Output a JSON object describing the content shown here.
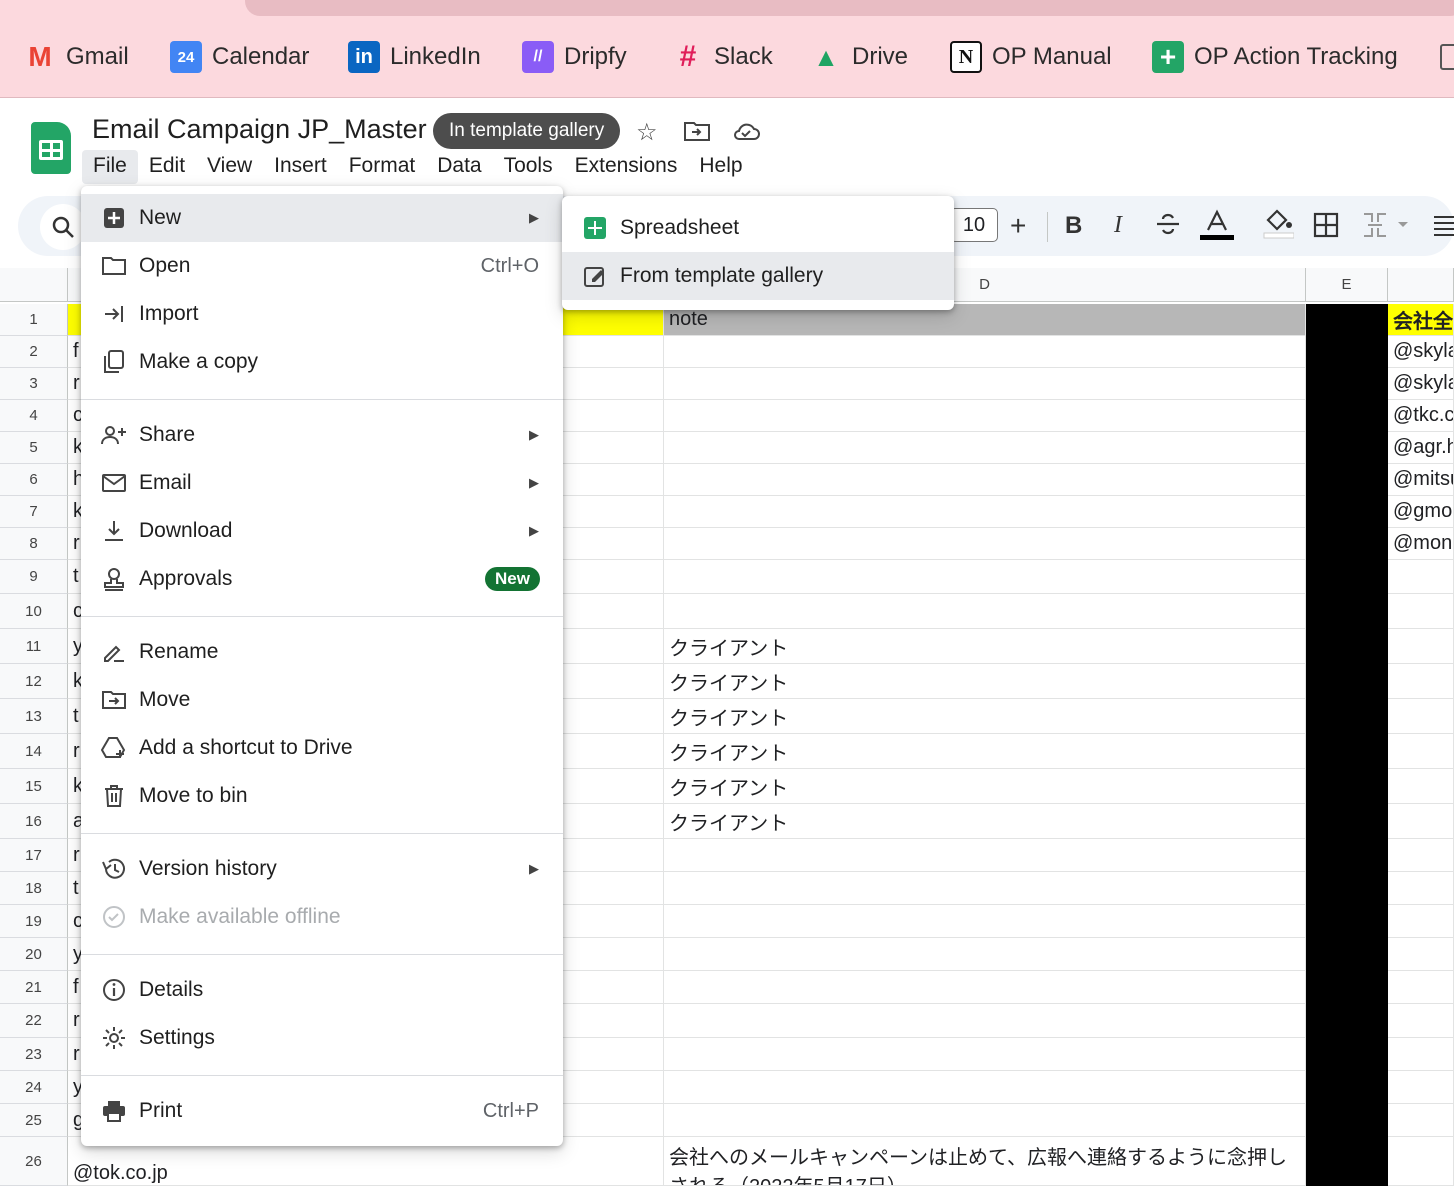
{
  "bookmarks": [
    {
      "label": "Gmail",
      "icon": "gmail-icon",
      "glyph": "M",
      "color": "#ea4335"
    },
    {
      "label": "Calendar",
      "icon": "calendar-icon",
      "glyph": "24",
      "color": "#4285f4"
    },
    {
      "label": "LinkedIn",
      "icon": "linkedin-icon",
      "glyph": "in",
      "color": "#0a66c2"
    },
    {
      "label": "Dripfy",
      "icon": "dripfy-icon",
      "glyph": "//",
      "color": "#8a5cf6"
    },
    {
      "label": "Slack",
      "icon": "slack-icon",
      "glyph": "#",
      "color": "#e01e5a"
    },
    {
      "label": "Drive",
      "icon": "drive-icon",
      "glyph": "▲",
      "color": "#1fa463"
    },
    {
      "label": "OP Manual",
      "icon": "notion-icon",
      "glyph": "N",
      "color": "#111111"
    },
    {
      "label": "OP Action Tracking",
      "icon": "sheets-plus-icon",
      "glyph": "+",
      "color": "#23a566"
    }
  ],
  "doc": {
    "title": "Email Campaign JP_Master",
    "badge": "In template gallery"
  },
  "menubar": [
    "File",
    "Edit",
    "View",
    "Insert",
    "Format",
    "Data",
    "Tools",
    "Extensions",
    "Help"
  ],
  "toolbar": {
    "font_size": "10",
    "plus": "+",
    "bold": "B",
    "italic": "I"
  },
  "columns": {
    "d": "D",
    "e": "E"
  },
  "rows": [
    "1",
    "2",
    "3",
    "4",
    "5",
    "6",
    "7",
    "8",
    "9",
    "10",
    "11",
    "12",
    "13",
    "14",
    "15",
    "16",
    "17",
    "18",
    "19",
    "20",
    "21",
    "22",
    "23",
    "24",
    "25",
    "26"
  ],
  "col_a_fragments": [
    "f",
    "r",
    "c",
    "k",
    "h",
    "k",
    "r",
    "t",
    "c",
    "y",
    "k",
    "t",
    "r",
    "k",
    "a",
    "r",
    "t",
    "c",
    "y",
    "f",
    "r",
    "r",
    "y",
    "g",
    "k"
  ],
  "col_a_row26": "@tok.co.jp",
  "col_d": {
    "header_note": "note",
    "client": "クライアント",
    "row26_line1": "会社へのメールキャンペーンは止めて、広報へ連絡するように念押し",
    "row26_line2": "される（2022年5月17日）"
  },
  "col_f": [
    "会社全",
    "@skyla",
    "@skyla",
    "@tkc.c",
    "@agr.h",
    "@mitsu",
    "@gmo",
    "@mon"
  ],
  "file_menu": {
    "new": "New",
    "open": "Open",
    "open_shortcut": "Ctrl+O",
    "import": "Import",
    "make_copy": "Make a copy",
    "share": "Share",
    "email": "Email",
    "download": "Download",
    "approvals": "Approvals",
    "approvals_badge": "New",
    "rename": "Rename",
    "move": "Move",
    "add_shortcut": "Add a shortcut to Drive",
    "move_to_bin": "Move to bin",
    "version_history": "Version history",
    "make_offline": "Make available offline",
    "details": "Details",
    "settings": "Settings",
    "print": "Print",
    "print_shortcut": "Ctrl+P"
  },
  "new_submenu": {
    "spreadsheet": "Spreadsheet",
    "from_template": "From template gallery"
  }
}
